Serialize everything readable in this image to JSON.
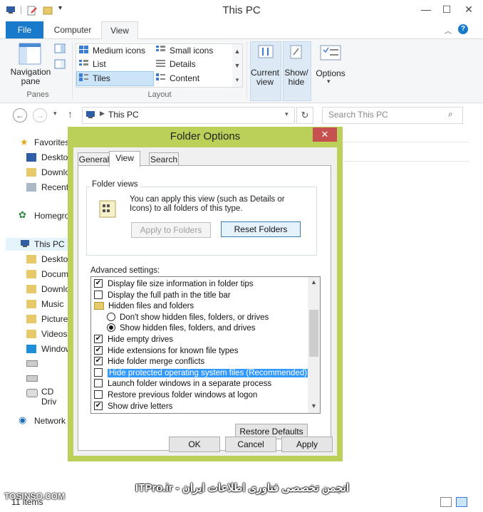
{
  "window": {
    "title": "This PC",
    "minimize": "—",
    "maximize": "☐",
    "close": "✕"
  },
  "ribbon": {
    "tabs": {
      "file": "File",
      "computer": "Computer",
      "view": "View"
    },
    "panes": {
      "nav_pane": "Navigation pane",
      "group": "Panes"
    },
    "layout": {
      "medium_icons": "Medium icons",
      "small_icons": "Small icons",
      "list": "List",
      "details": "Details",
      "tiles": "Tiles",
      "content": "Content",
      "group": "Layout"
    },
    "current_view": "Current view",
    "show_hide": "Show/ hide",
    "options": "Options"
  },
  "address": {
    "path": "This PC",
    "search_placeholder": "Search This PC"
  },
  "nav": {
    "favorites": "Favorites",
    "desktop": "Deskto",
    "downloads": "Downlo",
    "recent": "Recent",
    "homegroup": "Homegro",
    "this_pc": "This PC",
    "pc_desktop": "Deskto",
    "documents": "Docum",
    "pc_downloads": "Downlo",
    "music": "Music",
    "pictures": "Picture",
    "videos": "Videos",
    "windows": "Window",
    "cd_drive": "CD Driv",
    "network": "Network"
  },
  "dialog": {
    "title": "Folder Options",
    "tabs": {
      "general": "General",
      "view": "View",
      "search": "Search"
    },
    "folder_views": {
      "legend": "Folder views",
      "desc": "You can apply this view (such as Details or Icons) to all folders of this type.",
      "apply_btn": "Apply to Folders",
      "reset_btn": "Reset Folders"
    },
    "advanced_label": "Advanced settings:",
    "settings": [
      {
        "type": "check",
        "checked": true,
        "label": "Display file size information in folder tips"
      },
      {
        "type": "check",
        "checked": false,
        "label": "Display the full path in the title bar"
      },
      {
        "type": "folder",
        "label": "Hidden files and folders"
      },
      {
        "type": "radio",
        "checked": false,
        "label": "Don't show hidden files, folders, or drives"
      },
      {
        "type": "radio",
        "checked": true,
        "label": "Show hidden files, folders, and drives"
      },
      {
        "type": "check",
        "checked": true,
        "label": "Hide empty drives"
      },
      {
        "type": "check",
        "checked": true,
        "label": "Hide extensions for known file types"
      },
      {
        "type": "check",
        "checked": true,
        "label": "Hide folder merge conflicts"
      },
      {
        "type": "check",
        "checked": false,
        "selected": true,
        "label": "Hide protected operating system files (Recommended)"
      },
      {
        "type": "check",
        "checked": false,
        "label": "Launch folder windows in a separate process"
      },
      {
        "type": "check",
        "checked": false,
        "label": "Restore previous folder windows at logon"
      },
      {
        "type": "check",
        "checked": true,
        "label": "Show drive letters"
      }
    ],
    "restore_defaults": "Restore Defaults",
    "ok": "OK",
    "cancel": "Cancel",
    "apply": "Apply"
  },
  "status": {
    "items": "11 items"
  },
  "watermark": {
    "left": "TOSINSO.COM",
    "right": "ITPro.ir - انجمن تخصصی فناوری اطلاعات ایران"
  }
}
